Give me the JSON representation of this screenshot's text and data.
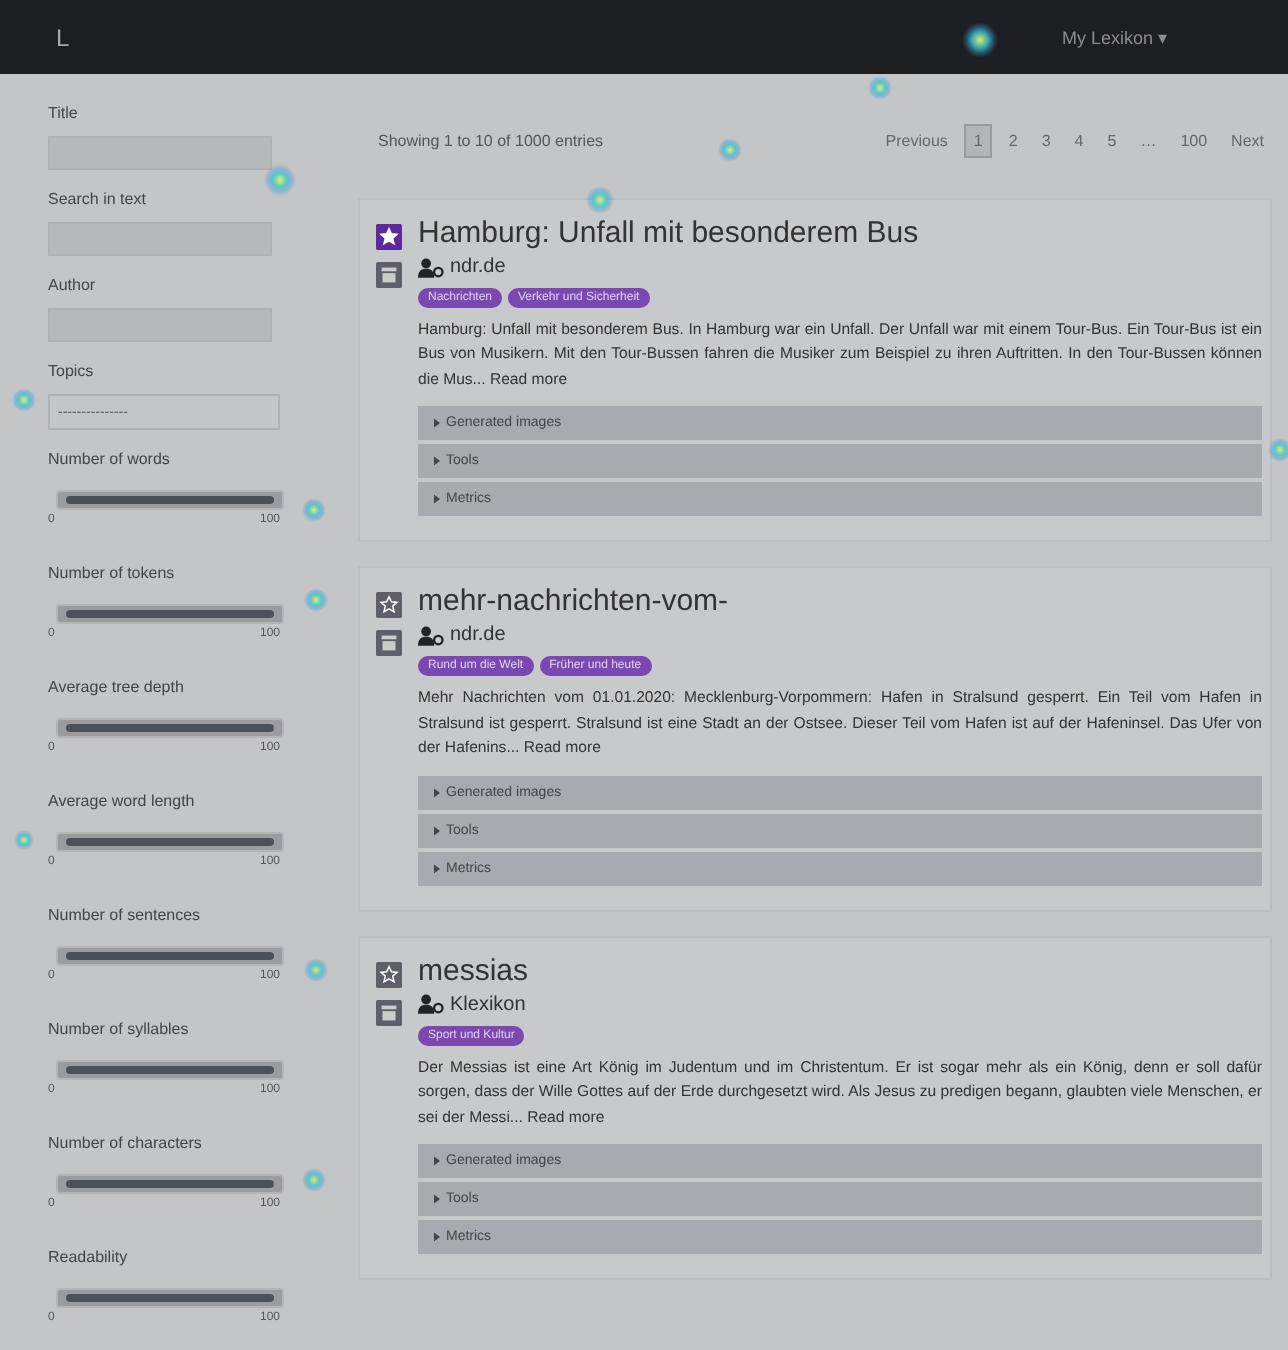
{
  "navbar": {
    "brand": "L",
    "menu": "My Lexikon ▾"
  },
  "sidebar": {
    "fields": [
      {
        "kind": "input",
        "label": "Title"
      },
      {
        "kind": "input",
        "label": "Search in text"
      },
      {
        "kind": "input",
        "label": "Author"
      },
      {
        "kind": "select",
        "label": "Topics",
        "placeholder": "---------------"
      },
      {
        "kind": "slider",
        "label": "Number of words",
        "level": 1,
        "min": "0",
        "max": "100"
      },
      {
        "kind": "slider",
        "label": "Number of tokens",
        "level": 1,
        "min": "0",
        "max": "100"
      },
      {
        "kind": "slider",
        "label": "Average tree depth",
        "level": 1,
        "min": "0",
        "max": "100"
      },
      {
        "kind": "slider",
        "label": "Average word length",
        "level": 1,
        "min": "0",
        "max": "100"
      },
      {
        "kind": "slider",
        "label": "Number of sentences",
        "level": 1,
        "min": "0",
        "max": "100"
      },
      {
        "kind": "slider",
        "label": "Number of syllables",
        "level": 1,
        "min": "0",
        "max": "100"
      },
      {
        "kind": "slider",
        "label": "Number of characters",
        "level": 1,
        "min": "0",
        "max": "100"
      },
      {
        "kind": "slider",
        "label": "Readability",
        "level": 1,
        "min": "0",
        "max": "100"
      }
    ]
  },
  "results": {
    "info": "Showing 1 to 10 of 1000 entries",
    "pagination": [
      {
        "label": "Previous",
        "selected": false
      },
      {
        "label": "1",
        "selected": true
      },
      {
        "label": "2",
        "selected": false
      },
      {
        "label": "3",
        "selected": false
      },
      {
        "label": "4",
        "selected": false
      },
      {
        "label": "5",
        "selected": false
      },
      {
        "label": "…",
        "selected": false
      },
      {
        "label": "100",
        "selected": false
      },
      {
        "label": "Next",
        "selected": false
      }
    ],
    "cards": [
      {
        "starred": true,
        "title": "Hamburg: Unfall mit besonderem Bus",
        "author": "ndr.de",
        "tags": [
          "Nachrichten",
          "Verkehr und Sicherheit"
        ],
        "text": "Hamburg: Unfall mit besonderem Bus. In Hamburg war ein Unfall. Der Unfall war mit einem Tour-Bus. Ein Tour-Bus ist ein Bus von Musikern. Mit den Tour-Bussen fahren die Musiker zum Beispiel zu ihren Auftritten. In den Tour-Bussen können die Mus...",
        "more": "Read more",
        "sections": [
          "Generated images",
          "Tools",
          "Metrics"
        ]
      },
      {
        "starred": false,
        "title": "mehr-nachrichten-vom-",
        "author": "ndr.de",
        "tags": [
          "Rund um die Welt",
          "Früher und heute"
        ],
        "text": "Mehr Nachrichten vom 01.01.2020: Mecklenburg-Vorpommern: Hafen in Stralsund gesperrt. Ein Teil vom Hafen in Stralsund ist gesperrt. Stralsund ist eine Stadt an der Ostsee. Dieser Teil vom Hafen ist auf der Hafeninsel. Das Ufer von der Hafenins...",
        "more": "Read more",
        "sections": [
          "Generated images",
          "Tools",
          "Metrics"
        ]
      },
      {
        "starred": false,
        "title": "messias",
        "author": "Klexikon",
        "tags": [
          "Sport und Kultur"
        ],
        "text": "Der Messias ist eine Art König im Judentum und im Christentum. Er ist sogar mehr als ein König, denn er soll dafür sorgen, dass der Wille Gottes auf der Erde durchgesetzt wird. Als Jesus zu predigen begann, glaubten viele Menschen, er sei der Messi...",
        "more": "Read more",
        "sections": [
          "Generated images",
          "Tools",
          "Metrics"
        ]
      }
    ]
  }
}
